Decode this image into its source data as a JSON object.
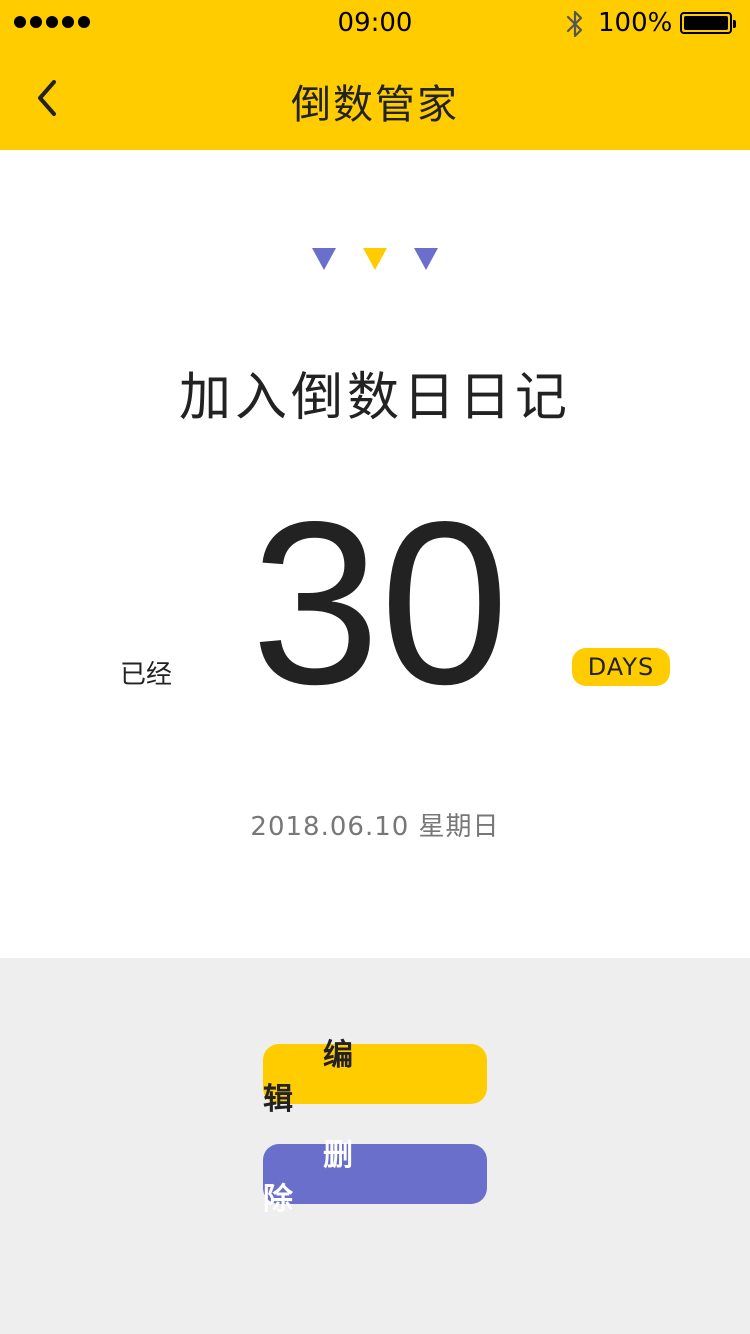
{
  "status_bar": {
    "time": "09:00",
    "battery": "100%",
    "bluetooth_icon": "bluetooth-icon",
    "signal_icon": "signal-dots-icon",
    "battery_icon": "battery-full-icon"
  },
  "nav": {
    "title": "倒数管家",
    "back_icon": "chevron-left-icon"
  },
  "event": {
    "title": "加入倒数日日记",
    "elapsed_label": "已经",
    "count": "30",
    "unit": "DAYS",
    "date": "2018.06.10 星期日"
  },
  "actions": {
    "edit_label": "编辑",
    "delete_label": "删除"
  },
  "colors": {
    "accent_yellow": "#FFCC00",
    "accent_purple": "#6A6FCB",
    "background_gray": "#EEEEEE"
  }
}
